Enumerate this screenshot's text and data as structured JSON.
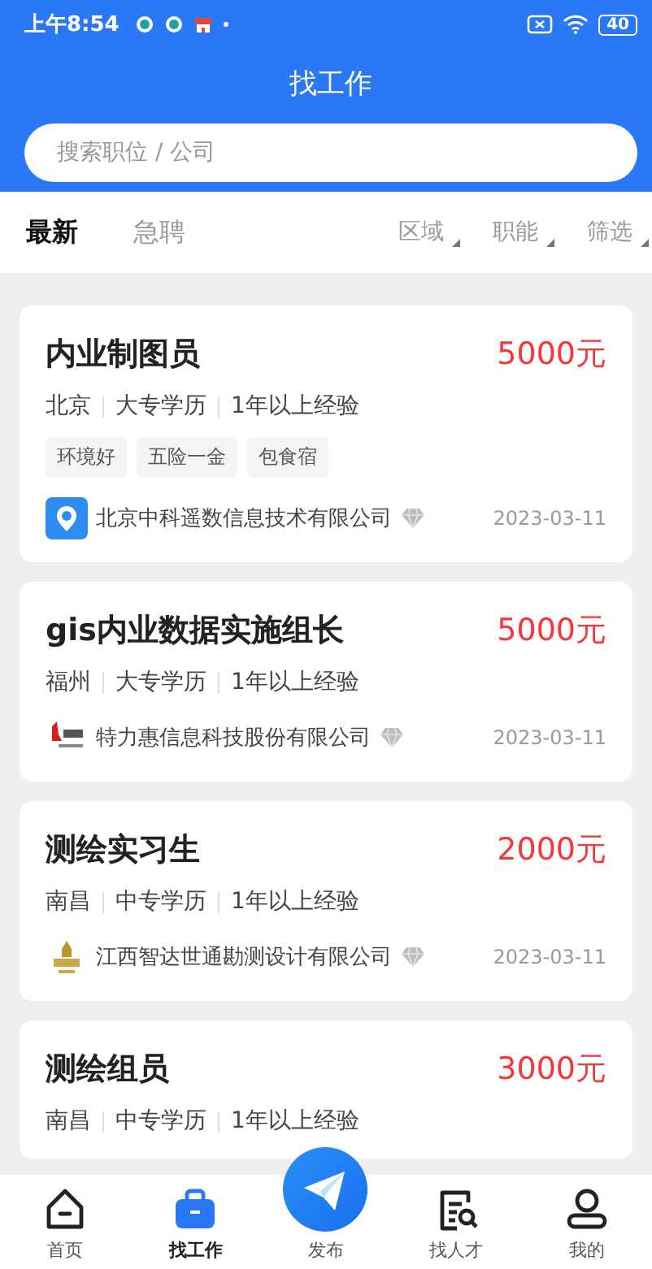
{
  "status_bar": {
    "time": "上午8:54",
    "battery": "40"
  },
  "header": {
    "title": "找工作"
  },
  "search": {
    "placeholder": "搜索职位 / 公司"
  },
  "tabs": [
    {
      "label": "最新",
      "selected": true
    },
    {
      "label": "急聘",
      "selected": false
    }
  ],
  "filters": [
    "区域",
    "职能",
    "筛选"
  ],
  "jobs": [
    {
      "title": "内业制图员",
      "salary": "5000元",
      "meta": [
        "北京",
        "大专学历",
        "1年以上经验"
      ],
      "tags": [
        "环境好",
        "五险一金",
        "包食宿"
      ],
      "company": {
        "name": "北京中科遥数信息技术有限公司",
        "kind": "app",
        "date": "2023-03-11"
      }
    },
    {
      "title": "gis内业数据实施组长",
      "salary": "5000元",
      "meta": [
        "福州",
        "大专学历",
        "1年以上经验"
      ],
      "company": {
        "name": "特力惠信息科技股份有限公司",
        "kind": "red",
        "date": "2023-03-11"
      }
    },
    {
      "title": "测绘实习生",
      "salary": "2000元",
      "meta": [
        "南昌",
        "中专学历",
        "1年以上经验"
      ],
      "company": {
        "name": "江西智达世通勘测设计有限公司",
        "kind": "gold",
        "date": "2023-03-11"
      }
    },
    {
      "title": "测绘组员",
      "salary": "3000元",
      "meta": [
        "南昌",
        "中专学历",
        "1年以上经验"
      ]
    }
  ],
  "nav": [
    {
      "label": "首页",
      "kind": "home",
      "selected": false
    },
    {
      "label": "找工作",
      "kind": "jobs",
      "selected": true
    },
    {
      "label": "发布",
      "kind": "publish",
      "selected": false
    },
    {
      "label": "找人才",
      "kind": "talent",
      "selected": false
    },
    {
      "label": "我的",
      "kind": "me",
      "selected": false
    }
  ]
}
